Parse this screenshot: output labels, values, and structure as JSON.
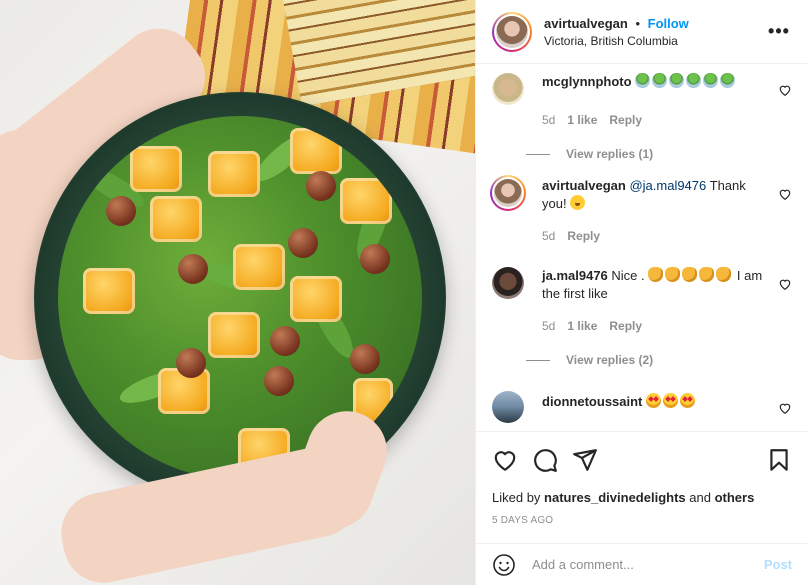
{
  "header": {
    "username": "avirtualvegan",
    "separator": "•",
    "follow_label": "Follow",
    "location": "Victoria, British Columbia",
    "more_label": "•••"
  },
  "comments": [
    {
      "username": "mcglynnphoto",
      "text": "",
      "emojis": [
        "salad",
        "salad",
        "salad",
        "salad",
        "salad",
        "salad"
      ],
      "age": "5d",
      "likes": "1 like",
      "reply": "Reply",
      "view_replies": "View replies (1)"
    },
    {
      "username": "avirtualvegan",
      "mention": "@ja.mal9476",
      "text": " Thank you! ",
      "emojis": [
        "love"
      ],
      "age": "5d",
      "reply": "Reply"
    },
    {
      "username": "ja.mal9476",
      "text": " Nice .",
      "text2": " I am the first like",
      "emojis": [
        "clap",
        "clap",
        "clap",
        "clap",
        "clap"
      ],
      "age": "5d",
      "likes": "1 like",
      "reply": "Reply",
      "view_replies": "View replies (2)"
    },
    {
      "username": "dionnetoussaint",
      "text": " ",
      "emojis": [
        "star",
        "star",
        "star"
      ]
    }
  ],
  "actions": {
    "liked_prefix": "Liked by ",
    "liked_user": "natures_divinedelights",
    "liked_mid": " and ",
    "liked_others": "others",
    "time_ago": "5 DAYS AGO"
  },
  "add_comment": {
    "placeholder": "Add a comment...",
    "post_label": "Post"
  },
  "colors": {
    "accent": "#0095f6",
    "post_disabled": "#b2dffc",
    "muted": "#8e8e8e",
    "text": "#262626"
  }
}
